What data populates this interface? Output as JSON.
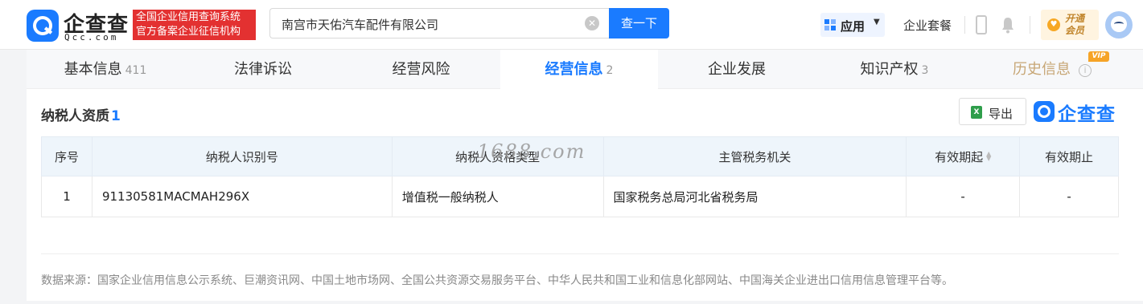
{
  "header": {
    "logo_cn": "企查查",
    "logo_en": "Qcc.com",
    "slogan_line1": "全国企业信用查询系统",
    "slogan_line2": "官方备案企业征信机构",
    "search_value": "南宫市天佑汽车配件有限公司",
    "search_button": "查一下",
    "apps_label": "应用",
    "package_label": "企业套餐",
    "vip_line1": "开通",
    "vip_line2": "会员"
  },
  "tabs": [
    {
      "label": "基本信息",
      "count": "411"
    },
    {
      "label": "法律诉讼",
      "count": ""
    },
    {
      "label": "经营风险",
      "count": ""
    },
    {
      "label": "经营信息",
      "count": "2"
    },
    {
      "label": "企业发展",
      "count": ""
    },
    {
      "label": "知识产权",
      "count": "3"
    },
    {
      "label": "历史信息",
      "count": ""
    }
  ],
  "vip_tag": "VIP",
  "section": {
    "title": "纳税人资质",
    "count": "1",
    "export_label": "导出",
    "brand": "企查查"
  },
  "table": {
    "headers": [
      "序号",
      "纳税人识别号",
      "纳税人资格类型",
      "主管税务机关",
      "有效期起",
      "有效期止"
    ],
    "rows": [
      [
        "1",
        "91130581MACMAH296X",
        "增值税一般纳税人",
        "国家税务总局河北省税务局",
        "-",
        "-"
      ]
    ]
  },
  "watermark": "1688.com",
  "footer": {
    "source": "数据来源：国家企业信用信息公示系统、巨潮资讯网、中国土地市场网、全国公共资源交易服务平台、中华人民共和国工业和信息化部网站、中国海关企业进出口信用信息管理平台等。"
  },
  "colors": {
    "accent": "#1a7bff",
    "brand_red": "#e33131",
    "history_tab": "#c7a675"
  }
}
